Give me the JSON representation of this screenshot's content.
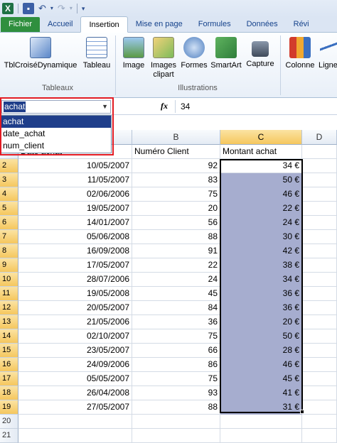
{
  "qat": {
    "excel_icon": "X",
    "save_icon": "save-icon",
    "undo_glyph": "↶",
    "redo_glyph": "↷"
  },
  "tabs": [
    "Fichier",
    "Accueil",
    "Insertion",
    "Mise en page",
    "Formules",
    "Données",
    "Révi"
  ],
  "ribbon": {
    "tableaux": {
      "pivot": "TblCroiséDynamique",
      "table": "Tableau",
      "label": "Tableaux"
    },
    "illustrations": {
      "image": "Image",
      "clipart_1": "Images",
      "clipart_2": "clipart",
      "shapes": "Formes",
      "smartart": "SmartArt",
      "capture": "Capture",
      "label": "Illustrations"
    },
    "charts": {
      "column": "Colonne",
      "line": "Ligne"
    }
  },
  "formula_bar": {
    "name_box": "achat",
    "fx": "fx",
    "value": "34"
  },
  "name_dropdown": [
    "achat",
    "date_achat",
    "num_client"
  ],
  "columns": [
    "B",
    "C",
    "D"
  ],
  "header_row": {
    "a": "Date achat",
    "b": "Numéro Client",
    "c": "Montant achat"
  },
  "rows": [
    {
      "n": "2",
      "a": "10/05/2007",
      "b": "92",
      "c": "34 €"
    },
    {
      "n": "3",
      "a": "11/05/2007",
      "b": "83",
      "c": "50 €"
    },
    {
      "n": "4",
      "a": "02/06/2006",
      "b": "75",
      "c": "46 €"
    },
    {
      "n": "5",
      "a": "19/05/2007",
      "b": "20",
      "c": "22 €"
    },
    {
      "n": "6",
      "a": "14/01/2007",
      "b": "56",
      "c": "24 €"
    },
    {
      "n": "7",
      "a": "05/06/2008",
      "b": "88",
      "c": "30 €"
    },
    {
      "n": "8",
      "a": "16/09/2008",
      "b": "91",
      "c": "42 €"
    },
    {
      "n": "9",
      "a": "17/05/2007",
      "b": "22",
      "c": "38 €"
    },
    {
      "n": "10",
      "a": "28/07/2006",
      "b": "24",
      "c": "34 €"
    },
    {
      "n": "11",
      "a": "19/05/2008",
      "b": "45",
      "c": "36 €"
    },
    {
      "n": "12",
      "a": "20/05/2007",
      "b": "84",
      "c": "36 €"
    },
    {
      "n": "13",
      "a": "21/05/2006",
      "b": "36",
      "c": "20 €"
    },
    {
      "n": "14",
      "a": "02/10/2007",
      "b": "75",
      "c": "50 €"
    },
    {
      "n": "15",
      "a": "23/05/2007",
      "b": "66",
      "c": "28 €"
    },
    {
      "n": "16",
      "a": "24/09/2006",
      "b": "86",
      "c": "46 €"
    },
    {
      "n": "17",
      "a": "05/05/2007",
      "b": "75",
      "c": "45 €"
    },
    {
      "n": "18",
      "a": "26/04/2008",
      "b": "93",
      "c": "41 €"
    },
    {
      "n": "19",
      "a": "27/05/2007",
      "b": "88",
      "c": "31 €"
    },
    {
      "n": "20",
      "a": "",
      "b": "",
      "c": ""
    },
    {
      "n": "21",
      "a": "",
      "b": "",
      "c": ""
    }
  ]
}
